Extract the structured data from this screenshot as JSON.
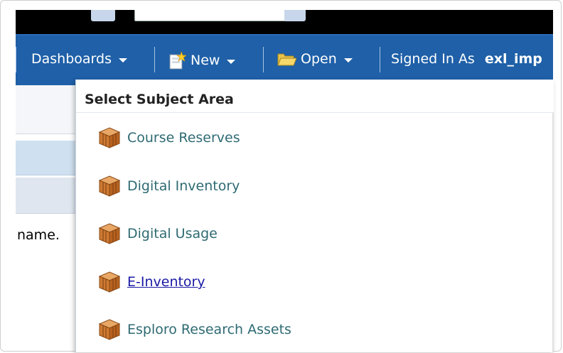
{
  "nav": {
    "dashboards": "Dashboards",
    "new": "New",
    "open": "Open",
    "signed_in_label": "Signed In As",
    "user": "exl_imp"
  },
  "left": {
    "text": "name."
  },
  "dropdown": {
    "title": "Select Subject Area",
    "items": [
      {
        "label": "Course Reserves",
        "icon": "subject-area-cube-icon"
      },
      {
        "label": "Digital Inventory",
        "icon": "subject-area-cube-icon"
      },
      {
        "label": "Digital Usage",
        "icon": "subject-area-cube-icon"
      },
      {
        "label": "E-Inventory",
        "icon": "subject-area-cube-icon",
        "hovered": true
      },
      {
        "label": "Esploro Research Assets",
        "icon": "subject-area-cube-icon"
      }
    ]
  },
  "colors": {
    "nav_bg": "#1f60a8",
    "item_text": "#2e6a72",
    "link_text": "#1a1aa6"
  }
}
